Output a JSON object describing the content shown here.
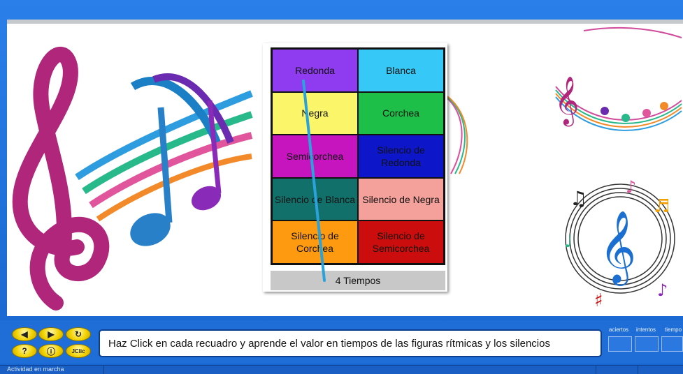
{
  "grid": {
    "cells": [
      {
        "label": "Redonda",
        "color": "#8f3cf0"
      },
      {
        "label": "Blanca",
        "color": "#36c8f6"
      },
      {
        "label": "Negra",
        "color": "#fbf56a"
      },
      {
        "label": "Corchea",
        "color": "#1dbf49"
      },
      {
        "label": "Semicorchea",
        "color": "#c615be"
      },
      {
        "label": "Silencio de Redonda",
        "color": "#0d17c9"
      },
      {
        "label": "Silencio de Blanca",
        "color": "#12706a"
      },
      {
        "label": "Silencio de Negra",
        "color": "#f5a19b"
      },
      {
        "label": "Silencio de Corchea",
        "color": "#fd9a0f"
      },
      {
        "label": "Silencio de Semicorchea",
        "color": "#cc0d0d"
      }
    ],
    "answer": "4 Tiempos"
  },
  "controls": {
    "prev_icon": "arrow-left-icon",
    "next_icon": "arrow-right-icon",
    "reload_icon": "reload-icon",
    "help_label": "?",
    "info_label": "ⓘ",
    "jclic_label": "JClic"
  },
  "message": "Haz Click en cada recuadro y aprende el valor en tiempos de las figuras rítmicas y los silencios",
  "counters": {
    "aciertos": "aciertos",
    "intentos": "intentos",
    "tiempo": "tiempo"
  },
  "status": "Actividad en marcha",
  "colors": {
    "frame_blue": "#1f6ed8",
    "button_yellow": "#f2d200"
  }
}
